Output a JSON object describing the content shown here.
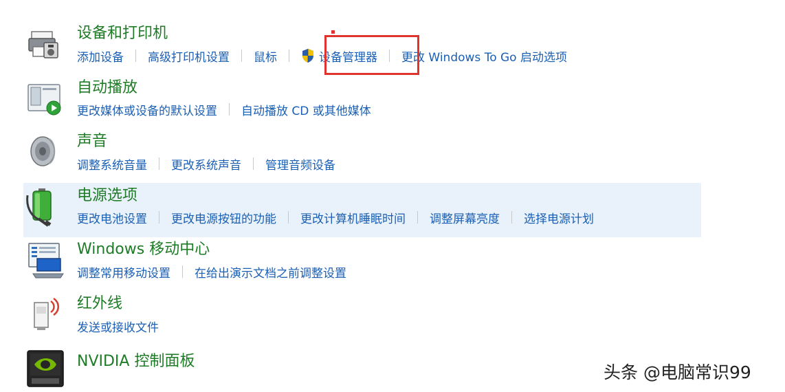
{
  "categories": [
    {
      "title": "设备和打印机",
      "icon": "printer-icon",
      "links": [
        "添加设备",
        "高级打印机设置",
        "鼠标",
        "设备管理器",
        "更改 Windows To Go 启动选项"
      ]
    },
    {
      "title": "自动播放",
      "icon": "autoplay-icon",
      "links": [
        "更改媒体或设备的默认设置",
        "自动播放 CD 或其他媒体"
      ]
    },
    {
      "title": "声音",
      "icon": "speaker-icon",
      "links": [
        "调整系统音量",
        "更改系统声音",
        "管理音频设备"
      ]
    },
    {
      "title": "电源选项",
      "icon": "power-battery-icon",
      "links": [
        "更改电池设置",
        "更改电源按钮的功能",
        "更改计算机睡眠时间",
        "调整屏幕亮度",
        "选择电源计划"
      ]
    },
    {
      "title": "Windows 移动中心",
      "icon": "mobility-center-icon",
      "links": [
        "调整常用移动设置",
        "在给出演示文档之前调整设置"
      ]
    },
    {
      "title": "红外线",
      "icon": "infrared-icon",
      "links": [
        "发送或接收文件"
      ]
    },
    {
      "title": "NVIDIA 控制面板",
      "icon": "nvidia-icon",
      "links": []
    }
  ],
  "highlight": {
    "highlighted_category": "电源选项",
    "boxed_link": "设备管理器",
    "box_color": "#e0332d"
  },
  "colors": {
    "title_green": "#1e7b26",
    "link_blue": "#1a5fb4",
    "highlight_bg": "#e9f2fb"
  },
  "watermark": "头条 @电脑常识99"
}
